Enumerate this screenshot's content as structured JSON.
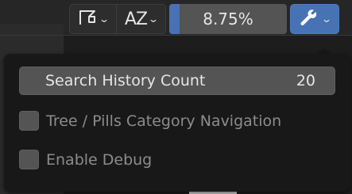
{
  "toolbar": {
    "filter_icon": "filter-funnel-icon",
    "sort_label": "AZ",
    "sort_icon": "sort-alpha-icon",
    "zoom_value": "8.75%",
    "zoom_level_percent": 8.75,
    "tools_icon": "wrench-icon",
    "dropdown_icon": "chevron-down-icon",
    "accent_color": "#4772b3"
  },
  "popup": {
    "search_history": {
      "label": "Search History Count",
      "value": "20"
    },
    "options": [
      {
        "label": "Tree / Pills Category Navigation",
        "checked": false
      },
      {
        "label": "Enable Debug",
        "checked": false
      }
    ]
  }
}
